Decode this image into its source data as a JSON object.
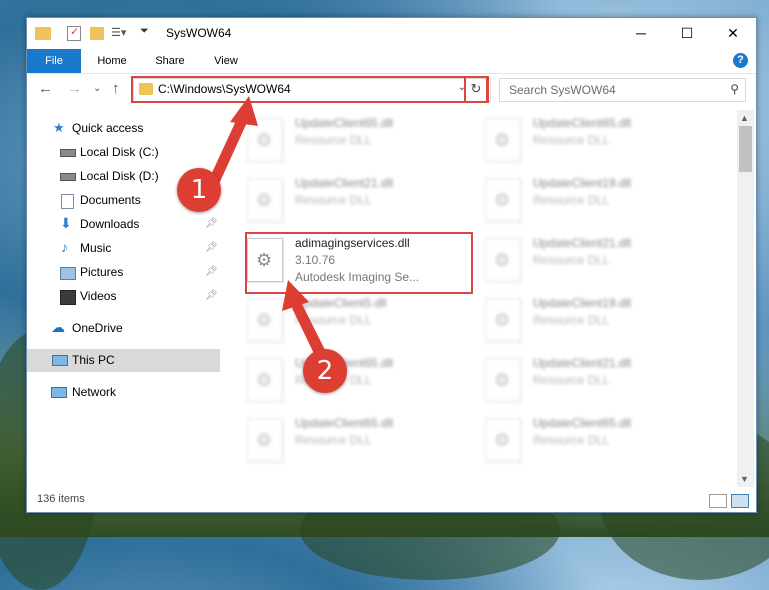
{
  "window": {
    "title": "SysWOW64"
  },
  "ribbon": {
    "tabs": [
      "File",
      "Home",
      "Share",
      "View"
    ],
    "help": "?"
  },
  "address": {
    "path": "C:\\Windows\\SysWOW64"
  },
  "search": {
    "placeholder": "Search SysWOW64"
  },
  "sidebar": {
    "items": [
      {
        "label": "Quick access"
      },
      {
        "label": "Local Disk (C:)"
      },
      {
        "label": "Local Disk (D:)"
      },
      {
        "label": "Documents"
      },
      {
        "label": "Downloads"
      },
      {
        "label": "Music"
      },
      {
        "label": "Pictures"
      },
      {
        "label": "Videos"
      },
      {
        "label": "OneDrive"
      },
      {
        "label": "This PC"
      },
      {
        "label": "Network"
      }
    ]
  },
  "files": {
    "left": [
      {
        "name": "UpdateClient65.dll",
        "desc": "Resource DLL"
      },
      {
        "name": "UpdateClient21.dll",
        "desc": "Resource DLL"
      },
      {
        "name": "adimagingservices.dll",
        "version": "3.10.76",
        "desc": "Autodesk Imaging Se..."
      },
      {
        "name": "UpdateClient5.dll",
        "desc": "Resource DLL"
      },
      {
        "name": "UpdateClient65.dll",
        "desc": "Resource DLL"
      },
      {
        "name": "UpdateClient65.dll",
        "desc": "Resource DLL"
      }
    ],
    "right": [
      {
        "name": "UpdateClient65.dll",
        "desc": "Resource DLL"
      },
      {
        "name": "UpdateClient19.dll",
        "desc": "Resource DLL"
      },
      {
        "name": "UpdateClient21.dll",
        "desc": "Resource DLL"
      },
      {
        "name": "UpdateClient19.dll",
        "desc": "Resource DLL"
      },
      {
        "name": "UpdateClient21.dll",
        "desc": "Resource DLL"
      },
      {
        "name": "UpdateClient65.dll",
        "desc": "Resource DLL"
      }
    ]
  },
  "status": {
    "count": "136 items"
  },
  "annotations": {
    "step1": "1",
    "step2": "2",
    "accent": "#dd3d33"
  }
}
